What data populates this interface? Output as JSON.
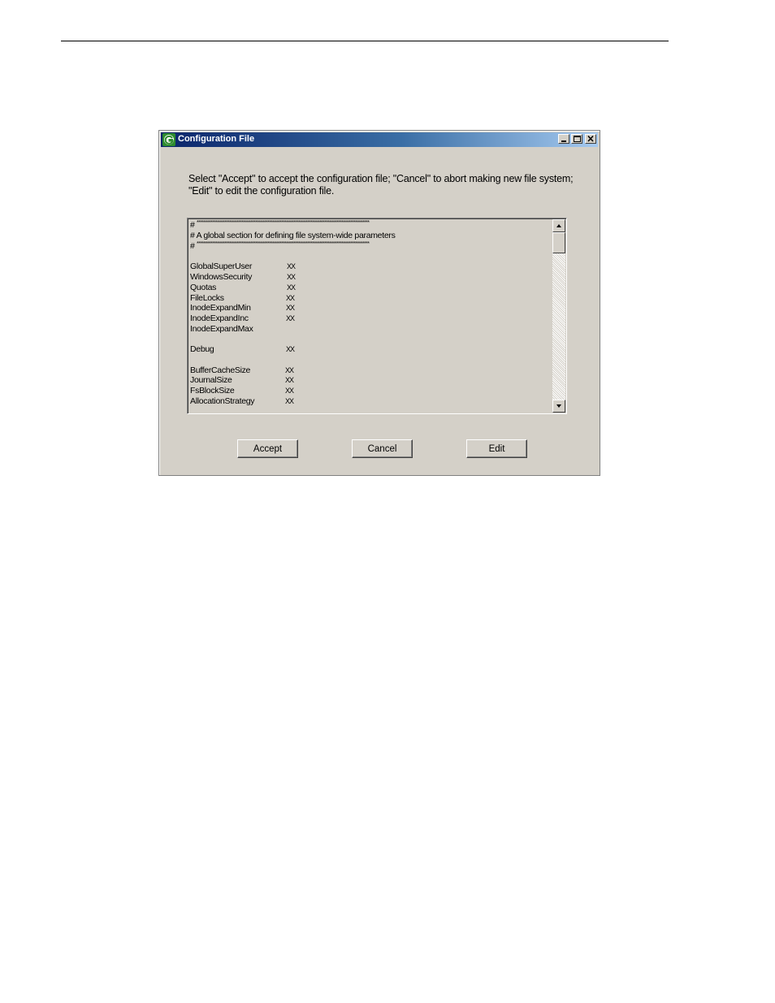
{
  "window": {
    "title": "Configuration File",
    "icon": "grass-valley-g-icon"
  },
  "instruction": "Select \"Accept\" to accept the configuration file; \"Cancel\" to abort making new file system; \"Edit\" to edit the configuration file.",
  "config_text": {
    "hash": "#",
    "stars": "****************************************************************************************************",
    "comment": "# A global section for defining file system-wide parameters",
    "entries": [
      {
        "key": "GlobalSuperUser",
        "value": "XX"
      },
      {
        "key": "WindowsSecurity",
        "value": "XX"
      },
      {
        "key": "Quotas",
        "value": "XX"
      },
      {
        "key": "FileLocks",
        "value": "XX"
      },
      {
        "key": "InodeExpandMin",
        "value": "XX"
      },
      {
        "key": "InodeExpandInc",
        "value": "XX"
      },
      {
        "key": "InodeExpandMax",
        "value": ""
      },
      {
        "key": "Debug",
        "value": "XX"
      },
      {
        "key": "BufferCacheSize",
        "value": "XX"
      },
      {
        "key": "JournalSize",
        "value": "XX"
      },
      {
        "key": "FsBlockSize",
        "value": "XX"
      },
      {
        "key": "AllocationStrategy",
        "value": "XX"
      }
    ]
  },
  "buttons": {
    "accept": "Accept",
    "cancel": "Cancel",
    "edit": "Edit"
  },
  "colors": {
    "titlebar_start": "#0a246a",
    "titlebar_end": "#a6caf0",
    "dialog_face": "#d4d0c8"
  }
}
